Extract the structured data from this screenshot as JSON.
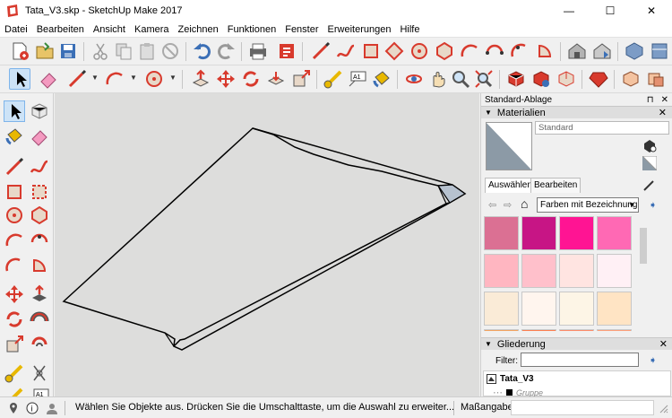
{
  "window": {
    "title": "Tata_V3.skp - SketchUp Make 2017",
    "minimize": "—",
    "maximize": "☐",
    "close": "✕"
  },
  "menu": [
    "Datei",
    "Bearbeiten",
    "Ansicht",
    "Kamera",
    "Zeichnen",
    "Funktionen",
    "Fenster",
    "Erweiterungen",
    "Hilfe"
  ],
  "tray": {
    "title": "Standard-Ablage",
    "pin": "⊓",
    "close": "✕",
    "materials": {
      "header": "Materialien",
      "name_value": "Standard",
      "tabs": [
        "Auswählen",
        "Bearbeiten"
      ],
      "library": "Farben mit Bezeichnung",
      "swatch_colors": [
        "#db7093",
        "#c71585",
        "#ff1493",
        "#ff69b4",
        "#ffb6c1",
        "#ffc0cb",
        "#ffe4e1",
        "#fff0f5",
        "#faebd7",
        "#fff5ee",
        "#fdf5e6",
        "#ffe4c4",
        "#f4a460",
        "#ff7f50",
        "#ff8c69",
        "#ffa07a"
      ]
    },
    "outliner": {
      "header": "Gliederung",
      "filter_label": "Filter:",
      "model": "Tata_V3",
      "group": "Gruppe"
    }
  },
  "status": {
    "text": "Wählen Sie Objekte aus. Drücken Sie die Umschalttaste, um die Auswahl zu erweiter...",
    "measure_label": "Maßangaben"
  },
  "colors": {
    "viewport_bg": "#dddddc",
    "tray_header_bg": "#dedede",
    "active_tool_bg": "#cde3f7"
  }
}
